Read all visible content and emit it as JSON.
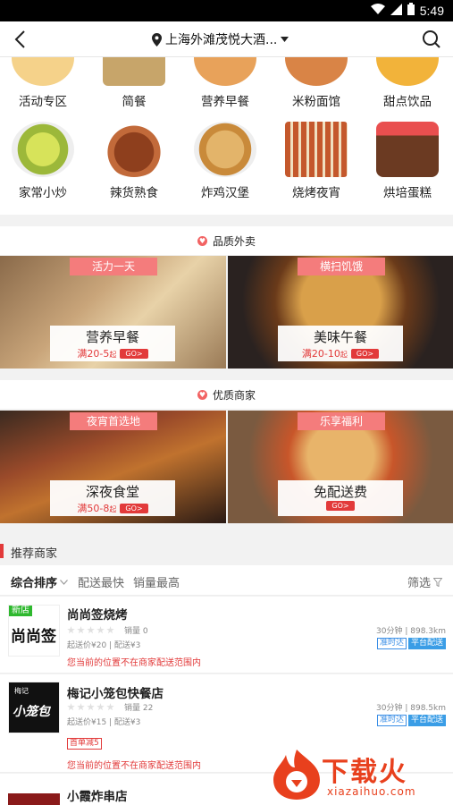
{
  "status": {
    "time": "5:49",
    "wifi_icon": "wifi-icon",
    "signal_icon": "signal-icon",
    "battery_icon": "battery-icon"
  },
  "header": {
    "location": "上海外滩茂悦大酒..."
  },
  "categories": [
    {
      "label": "活动专区",
      "color": "#f5d28a"
    },
    {
      "label": "简餐",
      "color": "#c7a56a"
    },
    {
      "label": "营养早餐",
      "color": "#e8a25a"
    },
    {
      "label": "米粉面馆",
      "color": "#d98446"
    },
    {
      "label": "甜点饮品",
      "color": "#f2b33a"
    },
    {
      "label": "家常小炒",
      "color": "#c6d94a"
    },
    {
      "label": "辣货熟食",
      "color": "#a5532c"
    },
    {
      "label": "炸鸡汉堡",
      "color": "#d9a35a"
    },
    {
      "label": "烧烤夜宵",
      "color": "#c4582c"
    },
    {
      "label": "烘培蛋糕",
      "color": "#8a4a2a"
    }
  ],
  "sections": {
    "quality_takeout": "品质外卖",
    "quality_merchant": "优质商家"
  },
  "promos": [
    {
      "tag": "活力一天",
      "title": "营养早餐",
      "sub_prefix": "满20-5",
      "sub_suffix": "起",
      "go": "GO>"
    },
    {
      "tag": "横扫饥饿",
      "title": "美味午餐",
      "sub_prefix": "满20-10",
      "sub_suffix": "起",
      "go": "GO>"
    },
    {
      "tag": "夜宵首选地",
      "title": "深夜食堂",
      "sub_prefix": "满50-8",
      "sub_suffix": "起",
      "go": "GO>"
    },
    {
      "tag": "乐享福利",
      "title": "免配送费",
      "sub_prefix": "",
      "sub_suffix": "",
      "go": "GO>"
    }
  ],
  "recommend": {
    "title": "推荐商家",
    "filters": {
      "sort": "综合排序",
      "fastest": "配送最快",
      "top_sales": "销量最高",
      "filter": "筛选"
    }
  },
  "shops": [
    {
      "name": "尚尚签烧烤",
      "logo_text": "尚尚签",
      "new_tag": "新店",
      "sales": "销量 0",
      "fee": "起送价¥20 | 配送¥3",
      "time_dist": "30分钟 | 898.3km",
      "ontime": "准时达",
      "platform": "平台配送",
      "warning": "您当前的位置不在商家配送范围内"
    },
    {
      "name": "梅记小笼包快餐店",
      "logo_text": "小笼包",
      "logo_top": "梅记",
      "sales": "销量 22",
      "fee": "起送价¥15 | 配送¥3",
      "time_dist": "30分钟 | 898.5km",
      "ontime": "准时达",
      "platform": "平台配送",
      "first_order": "首单减5",
      "warning": "您当前的位置不在商家配送范围内"
    },
    {
      "name": "小霞炸串店"
    }
  ],
  "watermark": {
    "text": "下载火",
    "url": "xiazaihuo.com"
  }
}
